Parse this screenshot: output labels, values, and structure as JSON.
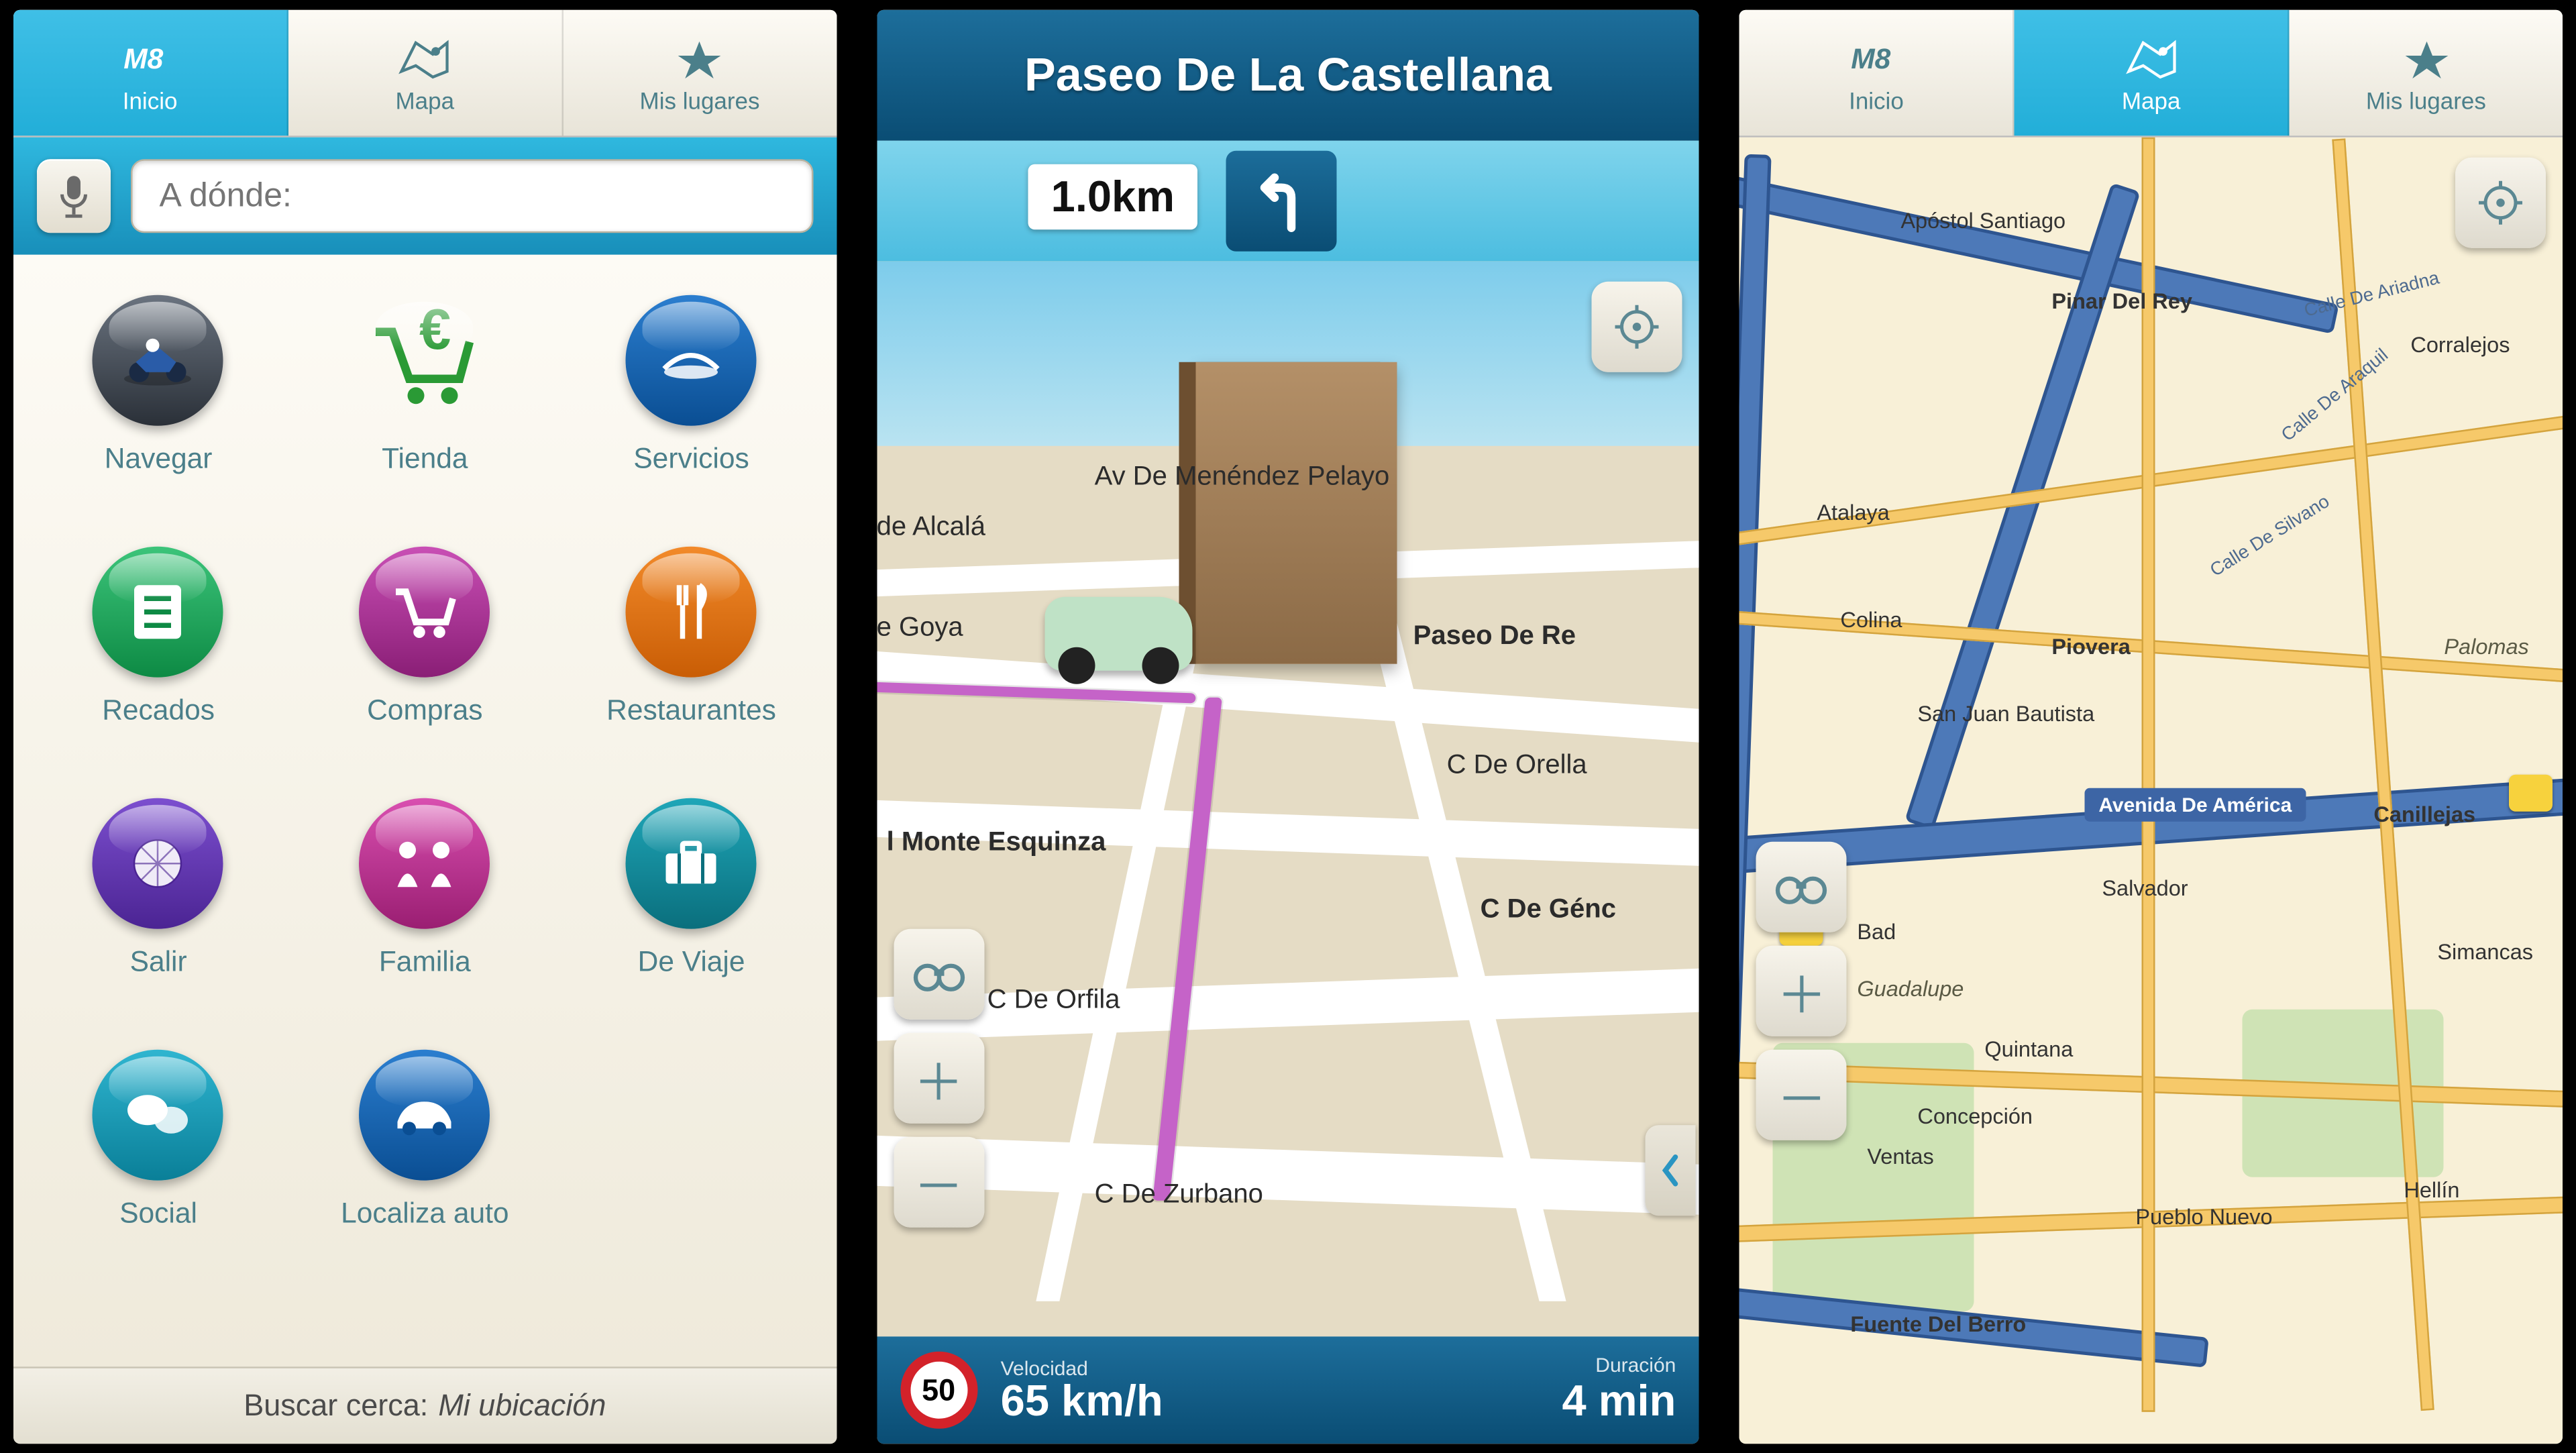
{
  "tabs": {
    "inicio": "Inicio",
    "mapa": "Mapa",
    "mis_lugares": "Mis lugares"
  },
  "search": {
    "placeholder": "A dónde:"
  },
  "categories": [
    {
      "label": "Navegar",
      "color_a": "#505a66",
      "color_b": "#2a3038",
      "icon": "moto"
    },
    {
      "label": "Tienda",
      "color_a": "#58c85f",
      "color_b": "#1f8f27",
      "icon": "cart-euro"
    },
    {
      "label": "Servicios",
      "color_a": "#2b7ecf",
      "color_b": "#0a4e93",
      "icon": "service"
    },
    {
      "label": "Recados",
      "color_a": "#3cc47a",
      "color_b": "#0d8a44",
      "icon": "list"
    },
    {
      "label": "Compras",
      "color_a": "#c94fb5",
      "color_b": "#8a1e76",
      "icon": "cart"
    },
    {
      "label": "Restaurantes",
      "color_a": "#f28a2a",
      "color_b": "#c95d05",
      "icon": "fork"
    },
    {
      "label": "Salir",
      "color_a": "#7c4fcf",
      "color_b": "#4b2493",
      "icon": "disco"
    },
    {
      "label": "Familia",
      "color_a": "#d94fb0",
      "color_b": "#9a1e72",
      "icon": "family"
    },
    {
      "label": "De Viaje",
      "color_a": "#1fa6b8",
      "color_b": "#0a6f7d",
      "icon": "suitcase"
    },
    {
      "label": "Social",
      "color_a": "#2fb5d0",
      "color_b": "#0a7f98",
      "icon": "bubbles"
    },
    {
      "label": "Localiza auto",
      "color_a": "#2b7ecf",
      "color_b": "#0a4e93",
      "icon": "car"
    }
  ],
  "footer": {
    "label": "Buscar cerca:",
    "value": "Mi ubicación"
  },
  "nav": {
    "street": "Paseo De La Castellana",
    "distance": "1.0km",
    "speed_limit": "50",
    "speed_label": "Velocidad",
    "speed_value": "65 km/h",
    "duration_label": "Duración",
    "duration_value": "4 min",
    "roads": [
      "Av De Menéndez Pelayo",
      "de Alcalá",
      "e Goya",
      "Paseo De Re",
      "C De Orella",
      "l Monte Esquinza",
      "C De Génc",
      "C De Orfila",
      "C De Zurbano"
    ]
  },
  "map2d": {
    "places": [
      "Apóstol Santiago",
      "Pinar Del Rey",
      "Corralejos",
      "Atalaya",
      "Colina",
      "Piovera",
      "San Juan Bautista",
      "Canillejas",
      "Salvador",
      "Bad",
      "Quintana",
      "Concepción",
      "Ventas",
      "Pueblo Nuevo",
      "Hellín",
      "Fuente Del Berro",
      "Palomas",
      "Simancas",
      "Guadalupe"
    ],
    "streets": [
      "Calle De Ariadna",
      "Calle De Araquil",
      "Calle De Silvano",
      "Avenida De América"
    ]
  }
}
